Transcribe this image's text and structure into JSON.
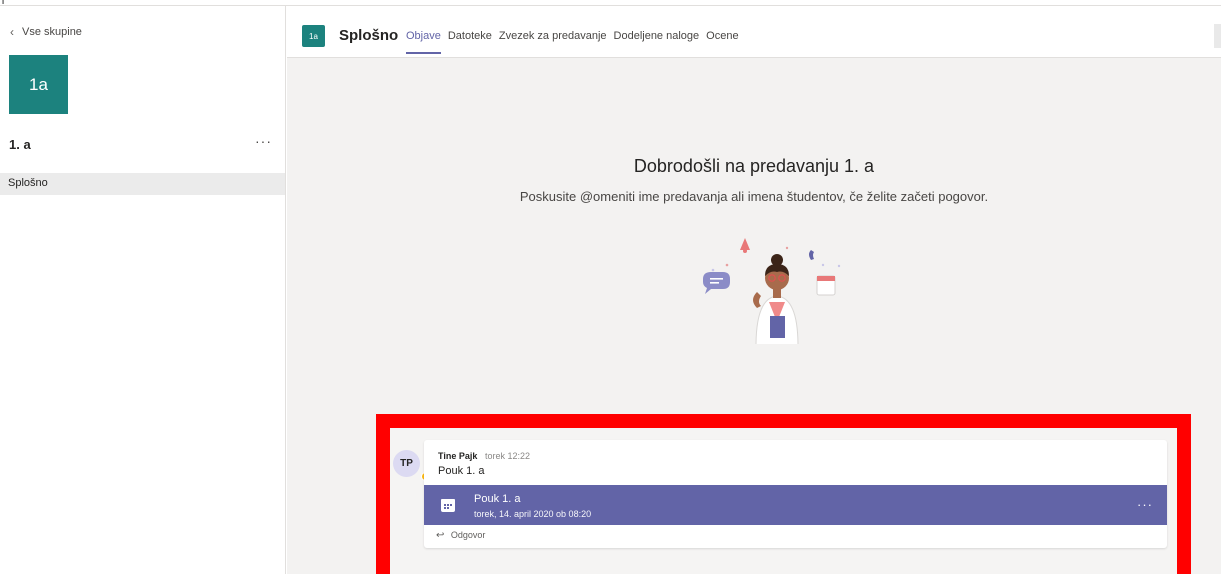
{
  "top_strip": {
    "glyph": "T"
  },
  "sidebar": {
    "back_label": "Vse skupine",
    "team_tile": "1a",
    "team_name": "1. a",
    "more_label": "···",
    "channels": [
      {
        "label": "Splošno"
      }
    ]
  },
  "header": {
    "channel_icon": "1a",
    "channel_title": "Splošno",
    "tabs": [
      {
        "label": "Objave"
      },
      {
        "label": "Datoteke"
      },
      {
        "label": "Zvezek za predavanje"
      },
      {
        "label": "Dodeljene naloge"
      },
      {
        "label": "Ocene"
      }
    ],
    "active_tab": "Objave"
  },
  "welcome": {
    "title": "Dobrodošli na predavanju 1. a",
    "subtitle": "Poskusite @omeniti ime predavanja ali imena študentov, če želite začeti pogovor."
  },
  "message": {
    "avatar_initials": "TP",
    "author": "Tine Pajk",
    "time": "torek 12:22",
    "text": "Pouk 1. a",
    "meeting_title": "Pouk 1. a",
    "meeting_date": "torek, 14. april 2020 ob 08:20",
    "more_label": "···",
    "reply_label": "Odgovor"
  },
  "colors": {
    "accent": "#6264a7",
    "team_tile": "#1c827e",
    "highlight": "#ff0000",
    "presence_away": "#fdb913"
  }
}
